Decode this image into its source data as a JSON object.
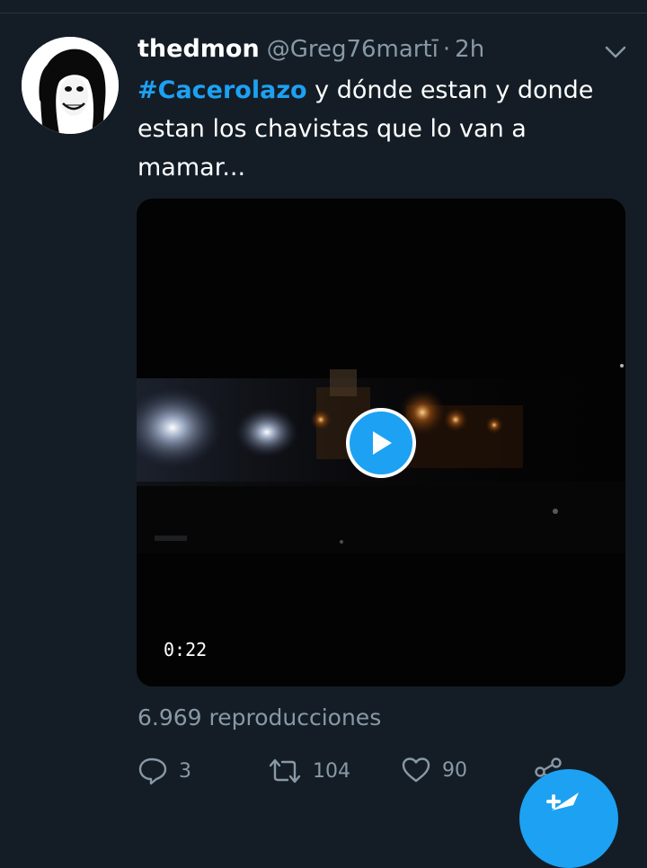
{
  "tweet": {
    "display_name": "thedmon",
    "handle": "@Greg76martī",
    "separator": "·",
    "time": "2h",
    "hashtag": "#Cacerolazo",
    "text": " y dónde estan y donde estan los chavistas que lo van a mamar...",
    "video": {
      "duration": "0:22"
    },
    "views": "6.969 reproducciones",
    "actions": {
      "reply_count": "3",
      "retweet_count": "104",
      "like_count": "90"
    }
  },
  "icons": {
    "menu": "chevron-down-icon",
    "reply": "reply-icon",
    "retweet": "retweet-icon",
    "like": "heart-icon",
    "share": "share-icon",
    "compose": "compose-icon",
    "play": "play-icon"
  },
  "colors": {
    "background": "#141d26",
    "accent": "#1da1f2",
    "secondary_text": "#8899a6"
  }
}
